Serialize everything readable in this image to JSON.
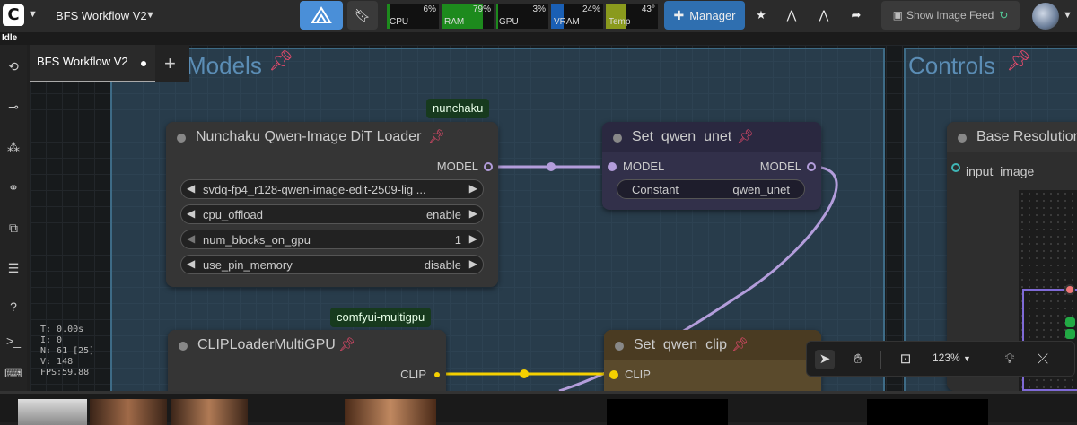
{
  "topbar": {
    "workflow_title": "BFS Workflow V2",
    "stats": [
      {
        "label": "CPU",
        "value": "6%",
        "color": "#1d8a1d",
        "fill": 0.06
      },
      {
        "label": "RAM",
        "value": "79%",
        "color": "#1d8a1d",
        "fill": 0.79
      },
      {
        "label": "GPU",
        "value": "3%",
        "color": "#1d8a1d",
        "fill": 0.03
      },
      {
        "label": "VRAM",
        "value": "24%",
        "color": "#1a5fb4",
        "fill": 0.24
      },
      {
        "label": "Temp",
        "value": "43°",
        "color": "#8a9a1d",
        "fill": 0.4
      }
    ],
    "manager_label": "Manager",
    "image_feed_label": "Show Image Feed"
  },
  "status": "Idle",
  "tabs": [
    {
      "label": "BFS Workflow V2",
      "active": true
    }
  ],
  "groups": {
    "models_title": "Models",
    "controls_title": "Controls"
  },
  "badges": {
    "nunchaku": "nunchaku",
    "multigpu": "comfyui-multigpu"
  },
  "nodes": {
    "loader": {
      "title": "Nunchaku Qwen-Image DiT Loader",
      "output": "MODEL",
      "widgets": [
        {
          "name": "",
          "value": "svdq-fp4_r128-qwen-image-edit-2509-lig ..."
        },
        {
          "name": "cpu_offload",
          "value": "enable"
        },
        {
          "name": "num_blocks_on_gpu",
          "value": "1"
        },
        {
          "name": "use_pin_memory",
          "value": "disable"
        }
      ]
    },
    "set_unet": {
      "title": "Set_qwen_unet",
      "input": "MODEL",
      "output": "MODEL",
      "widget_name": "Constant",
      "widget_value": "qwen_unet"
    },
    "base_res": {
      "title": "Base Resolution",
      "input": "input_image"
    },
    "clip_loader": {
      "title": "CLIPLoaderMultiGPU",
      "output": "CLIP"
    },
    "set_clip": {
      "title": "Set_qwen_clip",
      "input": "CLIP"
    }
  },
  "perf": {
    "t": "T: 0.00s",
    "i": "I: 0",
    "n": "N: 61 [25]",
    "v": "V: 148",
    "fps": "FPS:59.88"
  },
  "canvas_toolbar": {
    "zoom": "123%"
  },
  "colors": {
    "accent": "#2f6fb0",
    "model_link": "#b39ddb",
    "clip_link": "#f5d000"
  }
}
